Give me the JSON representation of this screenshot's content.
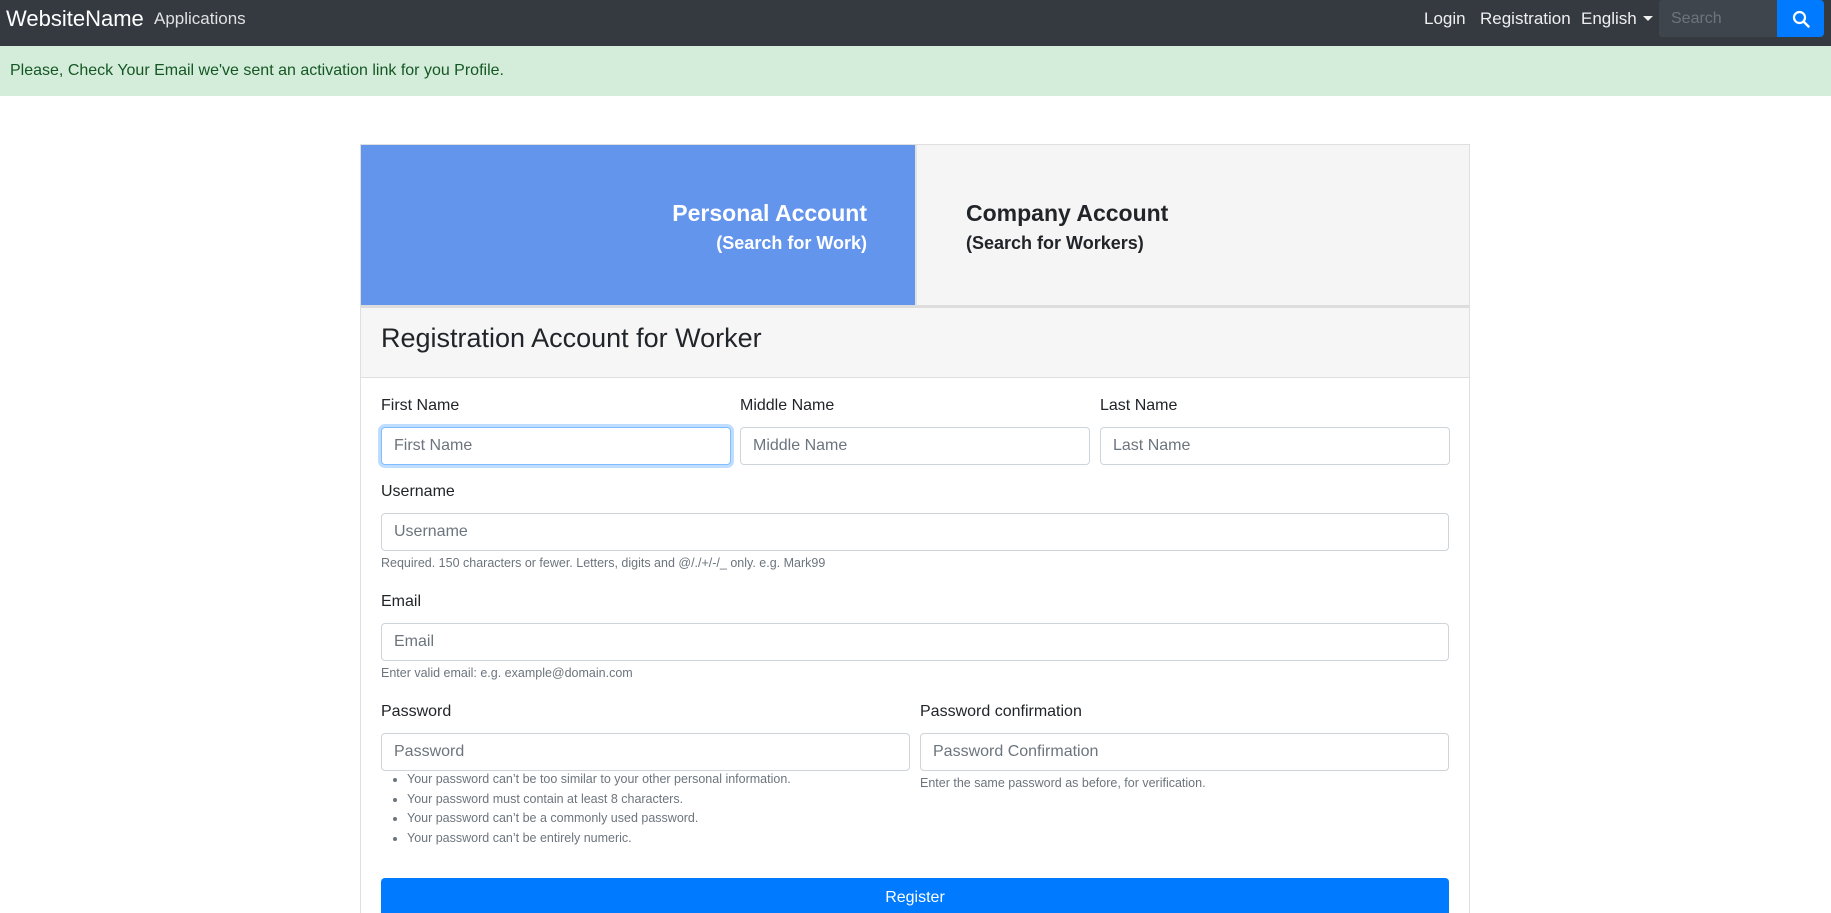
{
  "navbar": {
    "brand": "WebsiteName",
    "applications": "Applications",
    "login": "Login",
    "registration": "Registration",
    "language": "English",
    "search_placeholder": "Search"
  },
  "alert": {
    "message": "Please, Check Your Email we've sent an activation link for you Profile."
  },
  "tabs": {
    "personal_title": "Personal Account",
    "personal_sub": "(Search for Work)",
    "company_title": "Company Account",
    "company_sub": "(Search for Workers)"
  },
  "form": {
    "title": "Registration Account for Worker",
    "first_name_label": "First Name",
    "first_name_placeholder": "First Name",
    "middle_name_label": "Middle Name",
    "middle_name_placeholder": "Middle Name",
    "last_name_label": "Last Name",
    "last_name_placeholder": "Last Name",
    "username_label": "Username",
    "username_placeholder": "Username",
    "username_help": "Required. 150 characters or fewer. Letters, digits and @/./+/-/_ only. e.g. Mark99",
    "email_label": "Email",
    "email_placeholder": "Email",
    "email_help": "Enter valid email: e.g. example@domain.com",
    "password_label": "Password",
    "password_placeholder": "Password",
    "password_rules": [
      "Your password can’t be too similar to your other personal information.",
      "Your password must contain at least 8 characters.",
      "Your password can’t be a commonly used password.",
      "Your password can’t be entirely numeric."
    ],
    "password_confirm_label": "Password confirmation",
    "password_confirm_placeholder": "Password Confirmation",
    "password_confirm_help": "Enter the same password as before, for verification.",
    "register_button": "Register"
  },
  "colors": {
    "navbar_bg": "#343a40",
    "alert_bg": "#d4edda",
    "alert_text": "#155724",
    "personal_tab_bg": "#6495ed",
    "primary": "#007bff"
  },
  "icons": {
    "search": "search-icon",
    "language_dropdown": "caret-down-icon"
  }
}
